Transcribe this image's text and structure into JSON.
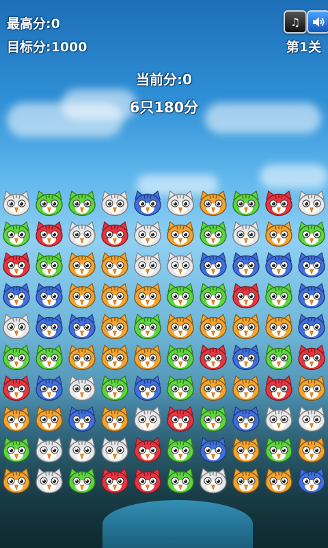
{
  "hud": {
    "best_label": "最高分:",
    "best_value": "0",
    "target_label": "目标分:",
    "target_value": "1000",
    "level_prefix": "第",
    "level_value": "1",
    "level_suffix": "关",
    "current_label": "当前分:",
    "current_value": "0",
    "bonus_count": "6",
    "bonus_mid": "只",
    "bonus_points": "180",
    "bonus_suffix": "分"
  },
  "buttons": {
    "music_icon": "music-note-icon",
    "volume_icon": "speaker-icon"
  },
  "colors": {
    "white": "#e7e7ea",
    "green": "#5cd63d",
    "red": "#e8343f",
    "blue": "#3f6fe0",
    "orange": "#f4a42e"
  },
  "board": [
    [
      "white",
      "green",
      "green",
      "white",
      "blue",
      "white",
      "orange",
      "green",
      "red",
      "white"
    ],
    [
      "green",
      "red",
      "white",
      "red",
      "white",
      "orange",
      "green",
      "white",
      "orange",
      "green"
    ],
    [
      "red",
      "green",
      "orange",
      "orange",
      "white",
      "white",
      "blue",
      "blue",
      "blue",
      "blue"
    ],
    [
      "blue",
      "blue",
      "orange",
      "orange",
      "orange",
      "green",
      "green",
      "red",
      "green",
      "blue"
    ],
    [
      "white",
      "blue",
      "blue",
      "orange",
      "green",
      "orange",
      "orange",
      "orange",
      "orange",
      "blue"
    ],
    [
      "green",
      "green",
      "orange",
      "orange",
      "orange",
      "green",
      "red",
      "blue",
      "green",
      "red"
    ],
    [
      "red",
      "blue",
      "white",
      "green",
      "blue",
      "green",
      "orange",
      "orange",
      "red",
      "orange"
    ],
    [
      "orange",
      "orange",
      "blue",
      "orange",
      "white",
      "red",
      "green",
      "blue",
      "white",
      "white"
    ],
    [
      "green",
      "white",
      "white",
      "white",
      "red",
      "green",
      "blue",
      "orange",
      "green",
      "orange"
    ],
    [
      "orange",
      "white",
      "green",
      "red",
      "red",
      "green",
      "white",
      "orange",
      "orange",
      "blue"
    ]
  ]
}
